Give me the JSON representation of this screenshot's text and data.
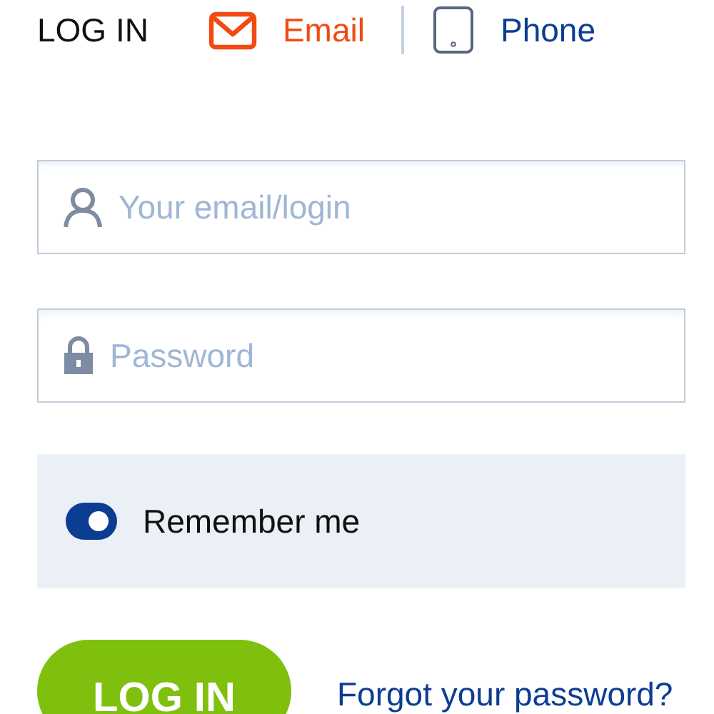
{
  "title": "LOG IN",
  "tabs": [
    {
      "label": "Email",
      "kind": "email",
      "selected": true
    },
    {
      "label": "Phone",
      "kind": "phone",
      "selected": false
    }
  ],
  "fields": [
    {
      "kind": "user",
      "placeholder": "Your email/login"
    },
    {
      "kind": "lock",
      "placeholder": "Password"
    }
  ],
  "remember": {
    "label": "Remember me",
    "on": true
  },
  "login_button": "LOG IN",
  "forgot_link": "Forgot your password?"
}
